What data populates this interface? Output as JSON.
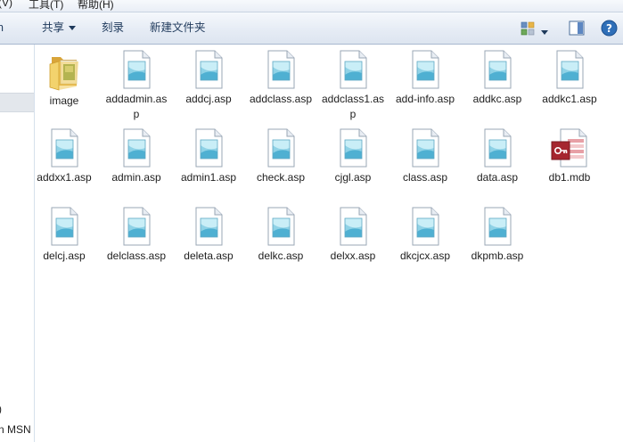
{
  "menubar": {
    "view": "(V)",
    "tools": "工具(T)",
    "help": "帮助(H)"
  },
  "toolbar": {
    "partial_left": "n",
    "share": "共享",
    "burn": "刻录",
    "new_folder": "新建文件夹"
  },
  "navpane": {
    "text1": ")",
    "text2": "n MSN"
  },
  "files": [
    {
      "name": "image",
      "type": "folder-icon"
    },
    {
      "name": "addadmin.asp",
      "type": "asp-file-icon"
    },
    {
      "name": "addcj.asp",
      "type": "asp-file-icon"
    },
    {
      "name": "addclass.asp",
      "type": "asp-file-icon"
    },
    {
      "name": "addclass1.asp",
      "type": "asp-file-icon"
    },
    {
      "name": "add-info.asp",
      "type": "asp-file-icon"
    },
    {
      "name": "addkc.asp",
      "type": "asp-file-icon"
    },
    {
      "name": "addkc1.asp",
      "type": "asp-file-icon"
    },
    {
      "name": "addxx1.asp",
      "type": "asp-file-icon"
    },
    {
      "name": "admin.asp",
      "type": "asp-file-icon"
    },
    {
      "name": "admin1.asp",
      "type": "asp-file-icon"
    },
    {
      "name": "check.asp",
      "type": "asp-file-icon"
    },
    {
      "name": "cjgl.asp",
      "type": "asp-file-icon"
    },
    {
      "name": "class.asp",
      "type": "asp-file-icon"
    },
    {
      "name": "data.asp",
      "type": "asp-file-icon"
    },
    {
      "name": "db1.mdb",
      "type": "access-db-icon"
    },
    {
      "name": "delcj.asp",
      "type": "asp-file-icon"
    },
    {
      "name": "delclass.asp",
      "type": "asp-file-icon"
    },
    {
      "name": "deleta.asp",
      "type": "asp-file-icon"
    },
    {
      "name": "delkc.asp",
      "type": "asp-file-icon"
    },
    {
      "name": "delxx.asp",
      "type": "asp-file-icon"
    },
    {
      "name": "dkcjcx.asp",
      "type": "asp-file-icon"
    },
    {
      "name": "dkpmb.asp",
      "type": "asp-file-icon"
    }
  ]
}
